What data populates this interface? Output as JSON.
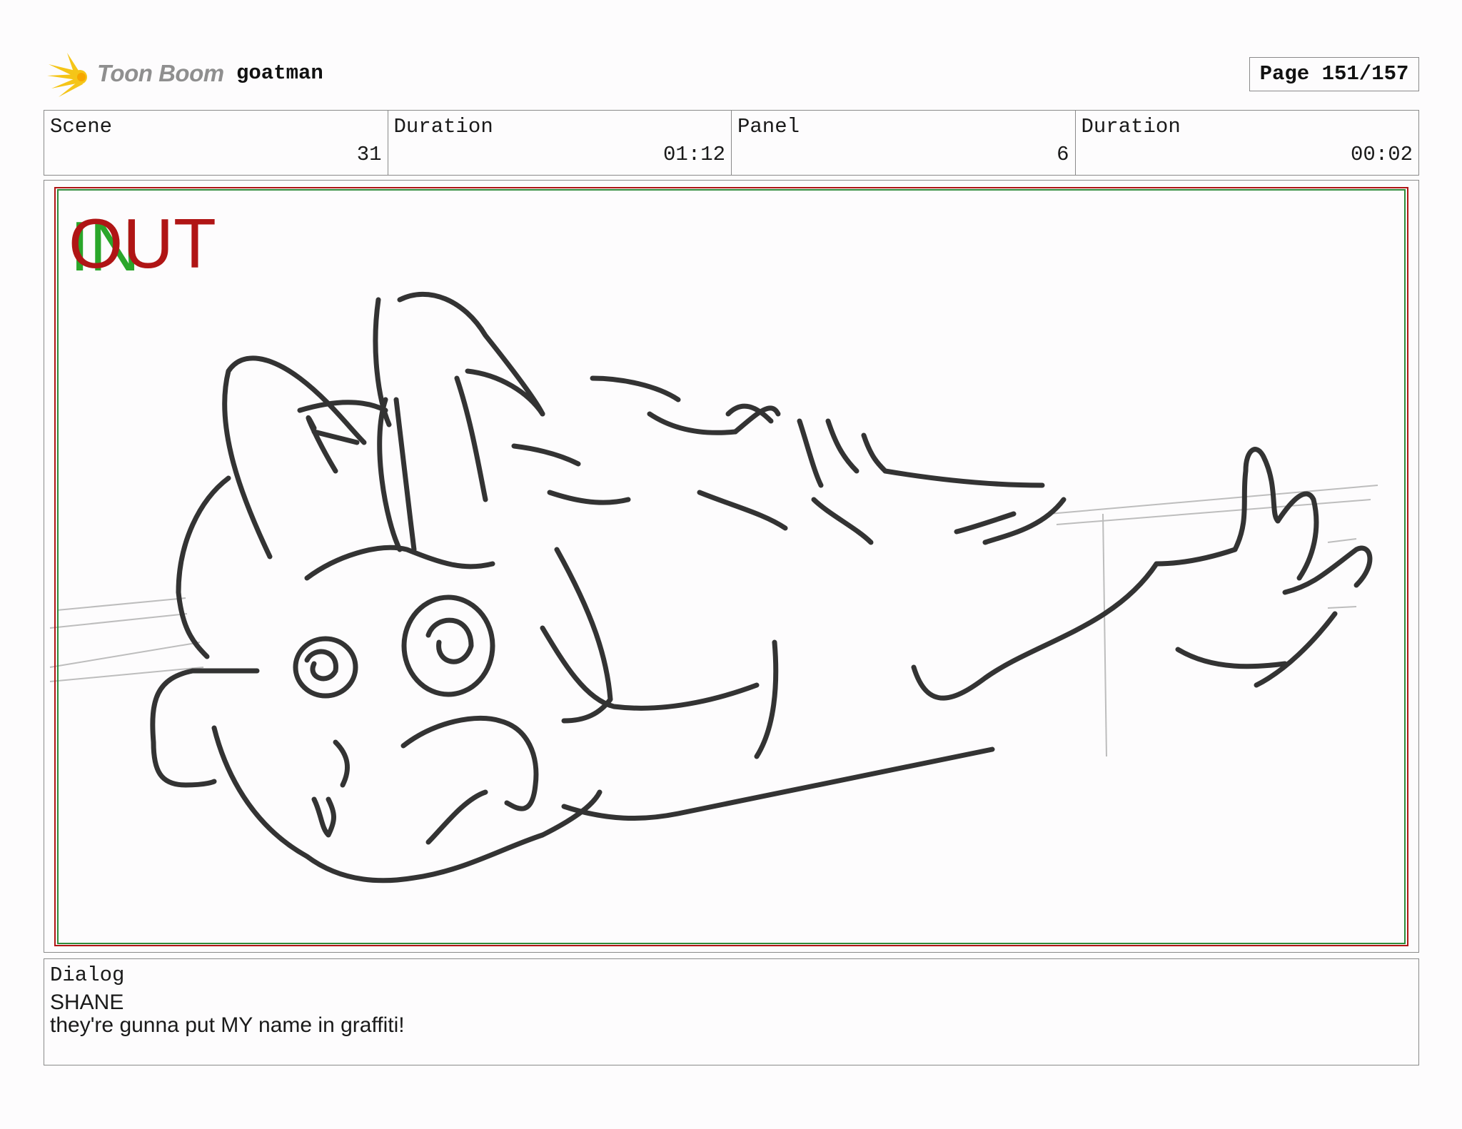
{
  "header": {
    "logo_text": "Toon Boom",
    "project_name": "goatman",
    "page_label": "Page 151/157"
  },
  "info": {
    "scene_label": "Scene",
    "scene_value": "31",
    "scene_duration_label": "Duration",
    "scene_duration_value": "01:12",
    "panel_label": "Panel",
    "panel_value": "6",
    "panel_duration_label": "Duration",
    "panel_duration_value": "00:02"
  },
  "panel": {
    "in_marker": "IN",
    "out_marker": "OUT",
    "safe_green_color": "#2e8b3a",
    "safe_red_color": "#b01515",
    "logo_color": "#f5c518"
  },
  "dialog": {
    "label": "Dialog",
    "speaker": "SHANE",
    "line": "they're gunna put MY name in graffiti!"
  }
}
